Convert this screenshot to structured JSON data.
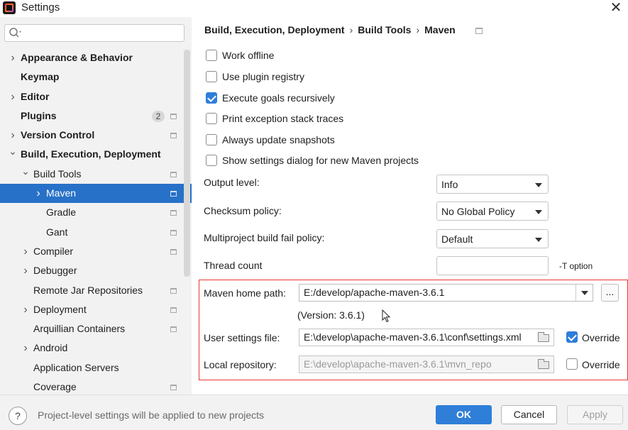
{
  "window": {
    "title": "Settings"
  },
  "sidebar": {
    "search_placeholder": "",
    "items": [
      {
        "label": "Appearance & Behavior",
        "level": 0,
        "expandable": true,
        "expanded": false,
        "bold": true,
        "selected": false,
        "badge": "",
        "project_icon": false
      },
      {
        "label": "Keymap",
        "level": 0,
        "expandable": false,
        "expanded": false,
        "bold": true,
        "selected": false,
        "badge": "",
        "project_icon": false
      },
      {
        "label": "Editor",
        "level": 0,
        "expandable": true,
        "expanded": false,
        "bold": true,
        "selected": false,
        "badge": "",
        "project_icon": false
      },
      {
        "label": "Plugins",
        "level": 0,
        "expandable": false,
        "expanded": false,
        "bold": true,
        "selected": false,
        "badge": "2",
        "project_icon": true
      },
      {
        "label": "Version Control",
        "level": 0,
        "expandable": true,
        "expanded": false,
        "bold": true,
        "selected": false,
        "badge": "",
        "project_icon": true
      },
      {
        "label": "Build, Execution, Deployment",
        "level": 0,
        "expandable": true,
        "expanded": true,
        "bold": true,
        "selected": false,
        "badge": "",
        "project_icon": false
      },
      {
        "label": "Build Tools",
        "level": 1,
        "expandable": true,
        "expanded": true,
        "bold": false,
        "selected": false,
        "badge": "",
        "project_icon": true
      },
      {
        "label": "Maven",
        "level": 2,
        "expandable": true,
        "expanded": false,
        "bold": false,
        "selected": true,
        "badge": "",
        "project_icon": true
      },
      {
        "label": "Gradle",
        "level": 2,
        "expandable": false,
        "expanded": false,
        "bold": false,
        "selected": false,
        "badge": "",
        "project_icon": true
      },
      {
        "label": "Gant",
        "level": 2,
        "expandable": false,
        "expanded": false,
        "bold": false,
        "selected": false,
        "badge": "",
        "project_icon": true
      },
      {
        "label": "Compiler",
        "level": 1,
        "expandable": true,
        "expanded": false,
        "bold": false,
        "selected": false,
        "badge": "",
        "project_icon": true
      },
      {
        "label": "Debugger",
        "level": 1,
        "expandable": true,
        "expanded": false,
        "bold": false,
        "selected": false,
        "badge": "",
        "project_icon": false
      },
      {
        "label": "Remote Jar Repositories",
        "level": 1,
        "expandable": false,
        "expanded": false,
        "bold": false,
        "selected": false,
        "badge": "",
        "project_icon": true
      },
      {
        "label": "Deployment",
        "level": 1,
        "expandable": true,
        "expanded": false,
        "bold": false,
        "selected": false,
        "badge": "",
        "project_icon": true
      },
      {
        "label": "Arquillian Containers",
        "level": 1,
        "expandable": false,
        "expanded": false,
        "bold": false,
        "selected": false,
        "badge": "",
        "project_icon": true
      },
      {
        "label": "Android",
        "level": 1,
        "expandable": true,
        "expanded": false,
        "bold": false,
        "selected": false,
        "badge": "",
        "project_icon": false
      },
      {
        "label": "Application Servers",
        "level": 1,
        "expandable": false,
        "expanded": false,
        "bold": false,
        "selected": false,
        "badge": "",
        "project_icon": false
      },
      {
        "label": "Coverage",
        "level": 1,
        "expandable": false,
        "expanded": false,
        "bold": false,
        "selected": false,
        "badge": "",
        "project_icon": true
      }
    ]
  },
  "breadcrumb": [
    "Build, Execution, Deployment",
    "Build Tools",
    "Maven"
  ],
  "checkboxes": [
    {
      "label": "Work offline",
      "checked": false
    },
    {
      "label": "Use plugin registry",
      "checked": false
    },
    {
      "label": "Execute goals recursively",
      "checked": true
    },
    {
      "label": "Print exception stack traces",
      "checked": false
    },
    {
      "label": "Always update snapshots",
      "checked": false
    },
    {
      "label": "Show settings dialog for new Maven projects",
      "checked": false
    }
  ],
  "fields": {
    "output_level": {
      "label": "Output level:",
      "value": "Info"
    },
    "checksum_policy": {
      "label": "Checksum policy:",
      "value": "No Global Policy"
    },
    "multiproject_policy": {
      "label": "Multiproject build fail policy:",
      "value": "Default"
    },
    "thread_count": {
      "label": "Thread count",
      "value": "",
      "suffix": "-T option"
    }
  },
  "maven_home": {
    "label": "Maven home path:",
    "value": "E:/develop/apache-maven-3.6.1",
    "browse_label": "...",
    "version": "(Version: 3.6.1)"
  },
  "user_settings": {
    "label": "User settings file:",
    "value": "E:\\develop\\apache-maven-3.6.1\\conf\\settings.xml",
    "override_label": "Override",
    "override": true
  },
  "local_repo": {
    "label": "Local repository:",
    "value": "E:\\develop\\apache-maven-3.6.1\\mvn_repo",
    "override_label": "Override",
    "override": false
  },
  "footer": {
    "help": "?",
    "hint": "Project-level settings will be applied to new projects",
    "ok": "OK",
    "cancel": "Cancel",
    "apply": "Apply"
  },
  "colors": {
    "selection": "#2871c8",
    "primary_button": "#2f7ed8",
    "highlight_box": "#e53935"
  }
}
